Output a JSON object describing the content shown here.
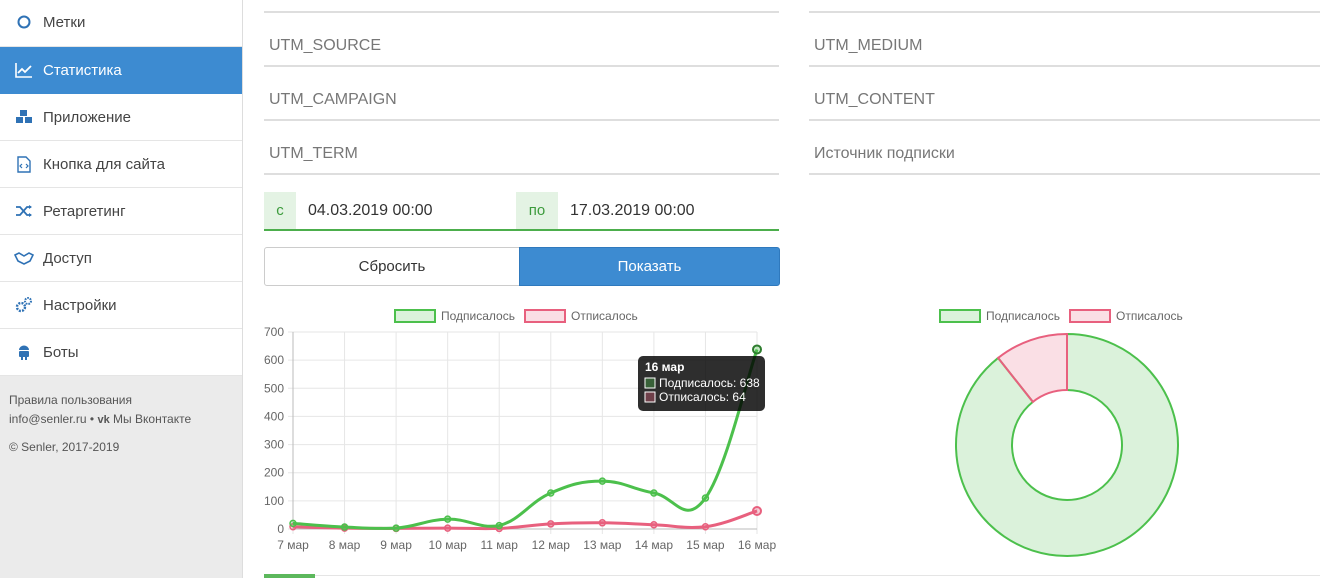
{
  "sidebar": {
    "items": [
      {
        "label": "Метки",
        "icon": "tag-circle-icon"
      },
      {
        "label": "Статистика",
        "icon": "line-chart-icon",
        "active": true
      },
      {
        "label": "Приложение",
        "icon": "cubes-icon"
      },
      {
        "label": "Кнопка для сайта",
        "icon": "code-file-icon"
      },
      {
        "label": "Ретаргетинг",
        "icon": "shuffle-icon"
      },
      {
        "label": "Доступ",
        "icon": "handshake-icon"
      },
      {
        "label": "Настройки",
        "icon": "gears-icon"
      },
      {
        "label": "Боты",
        "icon": "android-icon"
      }
    ],
    "footer": {
      "terms": "Правила пользования",
      "email": "info@senler.ru",
      "separator": "•",
      "vk": "Мы Вконтакте",
      "copyright": "© Senler, 2017-2019"
    }
  },
  "filters": {
    "utm_source": "UTM_SOURCE",
    "utm_medium": "UTM_MEDIUM",
    "utm_campaign": "UTM_CAMPAIGN",
    "utm_content": "UTM_CONTENT",
    "utm_term": "UTM_TERM",
    "source": "Источник подписки",
    "from_prefix": "с",
    "from_value": "04.03.2019 00:00",
    "to_prefix": "по",
    "to_value": "17.03.2019 00:00",
    "reset_label": "Сбросить",
    "show_label": "Показать"
  },
  "colors": {
    "accent": "#3d8bd1",
    "subscribed": "#4cc04c",
    "unsubscribed": "#e8607e"
  },
  "chart_data": [
    {
      "type": "line",
      "categories": [
        "7 мар",
        "8 мар",
        "9 мар",
        "10 мар",
        "11 мар",
        "12 мар",
        "13 мар",
        "14 мар",
        "15 мар",
        "16 мар"
      ],
      "series": [
        {
          "name": "Подписалось",
          "values": [
            20,
            7,
            3,
            35,
            12,
            128,
            170,
            128,
            110,
            638
          ]
        },
        {
          "name": "Отписалось",
          "values": [
            8,
            3,
            2,
            3,
            2,
            18,
            22,
            15,
            8,
            64
          ]
        }
      ],
      "ylim": [
        0,
        700
      ],
      "yticks": [
        0,
        100,
        200,
        300,
        400,
        500,
        600,
        700
      ],
      "legend": "top-center",
      "grid": true,
      "tooltip": {
        "title": "16 мар",
        "lines": [
          "Подписалось: 638",
          "Отписалось: 64"
        ]
      }
    },
    {
      "type": "pie",
      "subtype": "doughnut",
      "categories": [
        "Подписалось",
        "Отписалось"
      ],
      "values": [
        1216,
        145
      ],
      "legend": "top-center"
    }
  ]
}
